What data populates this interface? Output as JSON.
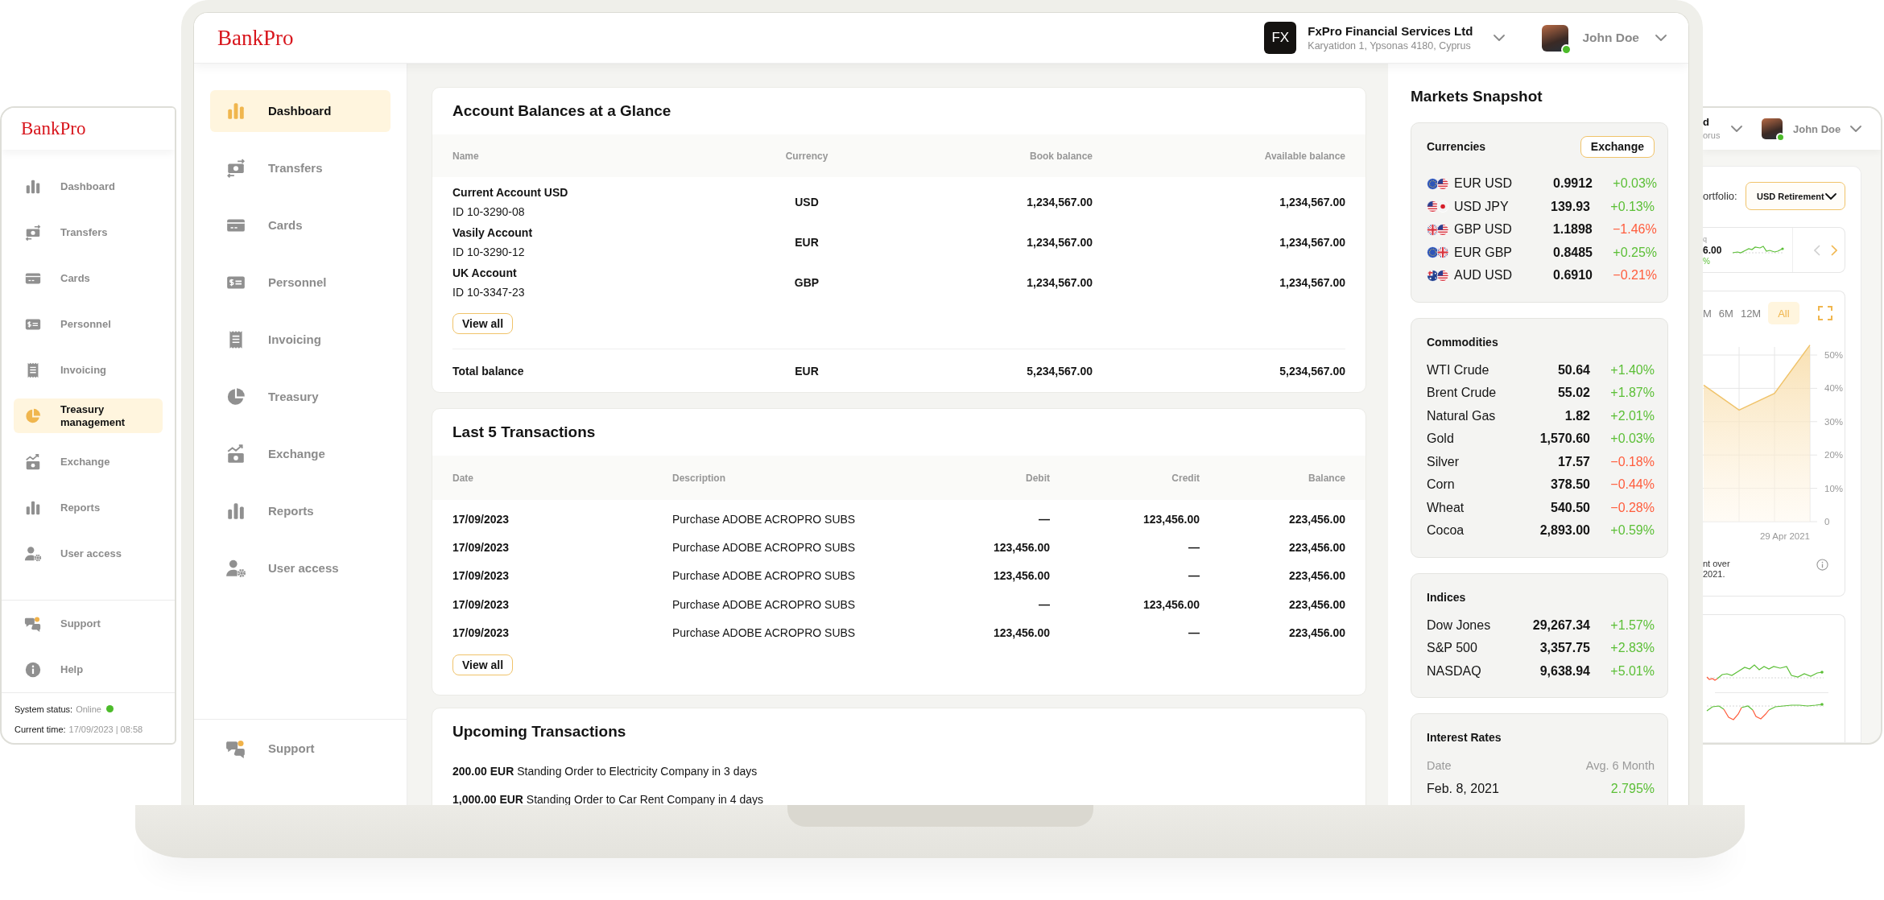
{
  "left_tablet": {
    "logo": "BankPro",
    "nav": [
      {
        "label": "Dashboard",
        "selected": false
      },
      {
        "label": "Transfers",
        "selected": false
      },
      {
        "label": "Cards",
        "selected": false
      },
      {
        "label": "Personnel",
        "selected": false
      },
      {
        "label": "Invoicing",
        "selected": false
      },
      {
        "label": "Treasury management",
        "selected": true
      },
      {
        "label": "Exchange",
        "selected": false
      },
      {
        "label": "Reports",
        "selected": false
      },
      {
        "label": "User access",
        "selected": false
      }
    ],
    "footer_nav": [
      {
        "label": "Support",
        "selected": false
      },
      {
        "label": "Help",
        "selected": false
      }
    ],
    "status": {
      "label": "System status:",
      "value": "Online",
      "online": true
    },
    "time": {
      "label": "Current time:",
      "value": "17/09/2023 | 08:58"
    }
  },
  "laptop": {
    "header": {
      "logo": "BankPro",
      "company": {
        "badge": "FX",
        "name": "FxPro Financial Services Ltd",
        "address": "Karyatidon 1, Ypsonas 4180, Cyprus"
      },
      "user": {
        "name": "John Doe",
        "online": true
      }
    },
    "sidebar": {
      "nav": [
        {
          "label": "Dashboard",
          "selected": true
        },
        {
          "label": "Transfers",
          "selected": false
        },
        {
          "label": "Cards",
          "selected": false
        },
        {
          "label": "Personnel",
          "selected": false
        },
        {
          "label": "Invoicing",
          "selected": false
        },
        {
          "label": "Treasury",
          "selected": false
        },
        {
          "label": "Exchange",
          "selected": false
        },
        {
          "label": "Reports",
          "selected": false
        },
        {
          "label": "User access",
          "selected": false
        }
      ],
      "footer_nav": [
        {
          "label": "Support",
          "selected": false
        }
      ]
    },
    "balances": {
      "title": "Account Balances at a Glance",
      "columns": [
        "Name",
        "Currency",
        "Book balance",
        "Available balance"
      ],
      "rows": [
        {
          "name": "Current Account USD",
          "id": "ID 10-3290-08",
          "currency": "USD",
          "book": "1,234,567.00",
          "available": "1,234,567.00"
        },
        {
          "name": "Vasily Account",
          "id": "ID 10-3290-12",
          "currency": "EUR",
          "book": "1,234,567.00",
          "available": "1,234,567.00"
        },
        {
          "name": "UK Account",
          "id": "ID 10-3347-23",
          "currency": "GBP",
          "book": "1,234,567.00",
          "available": "1,234,567.00"
        }
      ],
      "view_all": "View all",
      "total": {
        "name": "Total balance",
        "currency": "EUR",
        "book": "5,234,567.00",
        "available": "5,234,567.00"
      }
    },
    "transactions": {
      "title": "Last 5 Transactions",
      "columns": [
        "Date",
        "Description",
        "Debit",
        "Credit",
        "Balance"
      ],
      "rows": [
        {
          "date": "17/09/2023",
          "description": "Purchase ADOBE ACROPRO SUBS",
          "debit": "—",
          "credit": "123,456.00",
          "balance": "223,456.00"
        },
        {
          "date": "17/09/2023",
          "description": "Purchase ADOBE ACROPRO SUBS",
          "debit": "123,456.00",
          "credit": "—",
          "balance": "223,456.00"
        },
        {
          "date": "17/09/2023",
          "description": "Purchase ADOBE ACROPRO SUBS",
          "debit": "123,456.00",
          "credit": "—",
          "balance": "223,456.00"
        },
        {
          "date": "17/09/2023",
          "description": "Purchase ADOBE ACROPRO SUBS",
          "debit": "—",
          "credit": "123,456.00",
          "balance": "223,456.00"
        },
        {
          "date": "17/09/2023",
          "description": "Purchase ADOBE ACROPRO SUBS",
          "debit": "123,456.00",
          "credit": "—",
          "balance": "223,456.00"
        }
      ],
      "view_all": "View all"
    },
    "upcoming": {
      "title": "Upcoming Transactions",
      "items": [
        "**200.00 EUR** Standing Order to Electricity Company in 3 days",
        "**1,000.00 EUR** Standing Order to Car Rent Company in 4 days"
      ]
    },
    "markets": {
      "title": "Markets Snapshot",
      "currencies": {
        "title": "Currencies",
        "action": "Exchange",
        "rows": [
          {
            "name": "EUR USD",
            "value": "0.9912",
            "change": "+0.03%",
            "positive": true
          },
          {
            "name": "USD JPY",
            "value": "139.93",
            "change": "+0.13%",
            "positive": true
          },
          {
            "name": "GBP USD",
            "value": "1.1898",
            "change": "−1.46%",
            "positive": false
          },
          {
            "name": "EUR GBP",
            "value": "0.8485",
            "change": "+0.25%",
            "positive": true
          },
          {
            "name": "AUD USD",
            "value": "0.6910",
            "change": "−0.21%",
            "positive": false
          }
        ]
      },
      "commodities": {
        "title": "Commodities",
        "rows": [
          {
            "name": "WTI Crude",
            "value": "50.64",
            "change": "+1.40%",
            "positive": true
          },
          {
            "name": "Brent Crude",
            "value": "55.02",
            "change": "+1.87%",
            "positive": true
          },
          {
            "name": "Natural Gas",
            "value": "1.82",
            "change": "+2.01%",
            "positive": true
          },
          {
            "name": "Gold",
            "value": "1,570.60",
            "change": "+0.03%",
            "positive": true
          },
          {
            "name": "Silver",
            "value": "17.57",
            "change": "−0.18%",
            "positive": false
          },
          {
            "name": "Corn",
            "value": "378.50",
            "change": "−0.44%",
            "positive": false
          },
          {
            "name": "Wheat",
            "value": "540.50",
            "change": "−0.28%",
            "positive": false
          },
          {
            "name": "Cocoa",
            "value": "2,893.00",
            "change": "+0.59%",
            "positive": true
          }
        ]
      },
      "indices": {
        "title": "Indices",
        "rows": [
          {
            "name": "Dow Jones",
            "value": "29,267.34",
            "change": "+1.57%",
            "positive": true
          },
          {
            "name": "S&P 500",
            "value": "3,357.75",
            "change": "+2.83%",
            "positive": true
          },
          {
            "name": "NASDAQ",
            "value": "9,638.94",
            "change": "+5.01%",
            "positive": true
          }
        ]
      },
      "interest_rates": {
        "title": "Interest Rates",
        "columns": [
          "Date",
          "Avg. 6 Month"
        ],
        "rows": [
          {
            "date": "Feb. 8, 2021",
            "rate": "2.795%"
          }
        ]
      }
    }
  },
  "right_tablet": {
    "header": {
      "company": {
        "name": "d",
        "address": "orus"
      },
      "user": {
        "name": "John Doe",
        "online": true
      }
    },
    "portfolio": {
      "label": "ortfolio:",
      "value": "USD Retirement"
    },
    "ticker": {
      "symbol": "q",
      "value": "6.00",
      "change": "%",
      "positive": true
    },
    "range_tabs": [
      {
        "label": "M",
        "selected": false
      },
      {
        "label": "6M",
        "selected": false
      },
      {
        "label": "12M",
        "selected": false
      },
      {
        "label": "All",
        "selected": true
      }
    ],
    "chart_data": {
      "type": "area",
      "grid": true,
      "series": [
        {
          "color": "#f0c36a",
          "values": [
            41,
            33.5,
            38.5,
            53
          ]
        }
      ],
      "ylim": [
        0,
        53
      ],
      "yticks": [
        {
          "value": 0,
          "label": "0"
        },
        {
          "value": 10,
          "label": "10%"
        },
        {
          "value": 20,
          "label": "20%"
        },
        {
          "value": 30,
          "label": "30%"
        },
        {
          "value": 40,
          "label": "40%"
        },
        {
          "value": 50,
          "label": "50%"
        }
      ],
      "annotations": [
        "29 Apr 2021"
      ]
    },
    "note": [
      "nt over",
      "2021."
    ]
  }
}
